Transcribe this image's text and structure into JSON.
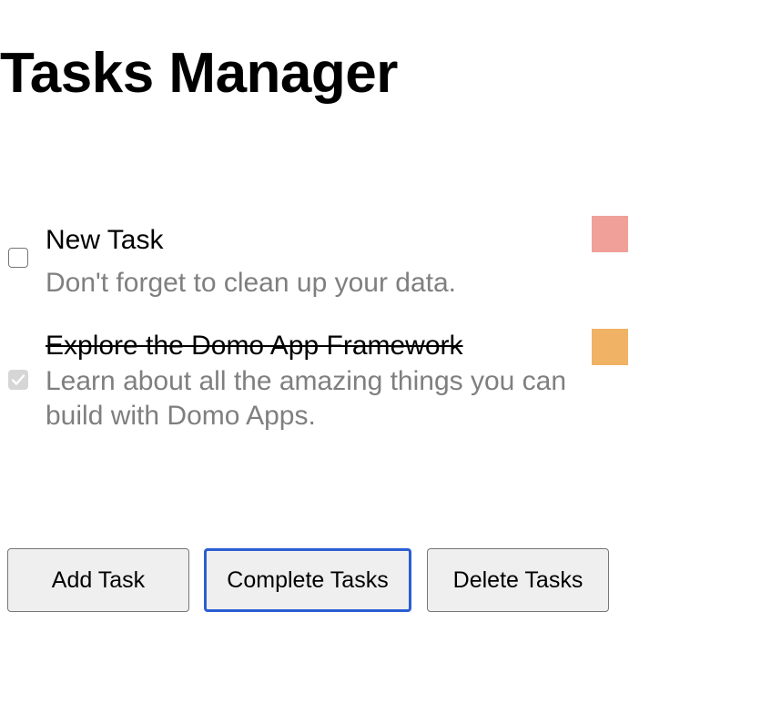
{
  "header": {
    "title": "Tasks Manager"
  },
  "tasks": [
    {
      "title": "New Task",
      "description": "Don't forget to clean up your data.",
      "completed": false,
      "color": "#f0a098"
    },
    {
      "title": "Explore the Domo App Framework",
      "description": "Learn about all the amazing things you can build with Domo Apps.",
      "completed": true,
      "color": "#f0b264"
    }
  ],
  "actions": {
    "add_label": "Add Task",
    "complete_label": "Complete Tasks",
    "delete_label": "Delete Tasks"
  },
  "colors": {
    "focus_ring": "#2c5ed3",
    "description_text": "#7f7f7f",
    "button_background": "#efefef"
  }
}
